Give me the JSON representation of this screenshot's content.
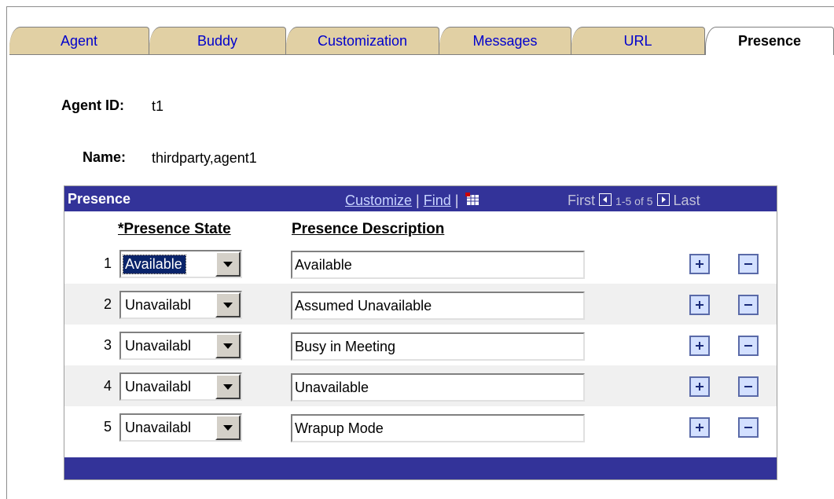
{
  "tabs": [
    "Agent",
    "Buddy",
    "Customization",
    "Messages",
    "URL",
    "Presence"
  ],
  "agent": {
    "id_label": "Agent ID:",
    "id_value": "t1",
    "name_label": "Name:",
    "name_value": "thirdparty,agent1"
  },
  "grid": {
    "title": "Presence",
    "customize": "Customize",
    "sep1": " | ",
    "find": "Find",
    "sep2": " |",
    "first": "First",
    "range": "1-5 of 5",
    "last": "Last",
    "col_state": "*Presence State",
    "col_desc": "Presence Description",
    "rows": [
      {
        "num": "1",
        "state": "Available",
        "desc": "Available"
      },
      {
        "num": "2",
        "state": "Unavailabl",
        "desc": "Assumed Unavailable"
      },
      {
        "num": "3",
        "state": "Unavailabl",
        "desc": "Busy in Meeting"
      },
      {
        "num": "4",
        "state": "Unavailabl",
        "desc": "Unavailable"
      },
      {
        "num": "5",
        "state": "Unavailabl",
        "desc": "Wrapup Mode"
      }
    ]
  },
  "colors": {
    "header": "#333399",
    "tab": "#e1d0a4",
    "link": "#0000cc"
  }
}
